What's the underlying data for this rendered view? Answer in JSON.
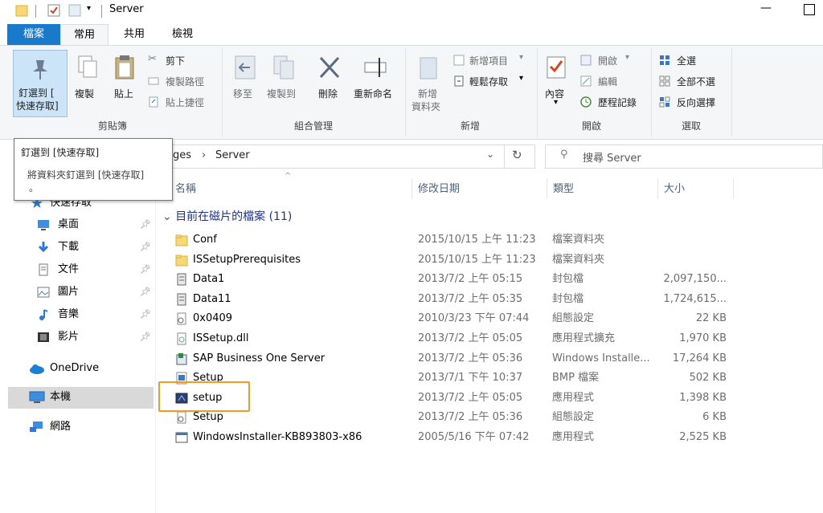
{
  "window": {
    "title": "Server"
  },
  "ribbon": {
    "tabs": [
      "檔案",
      "常用",
      "共用",
      "檢視"
    ],
    "clipboard": {
      "group_label": "剪貼簿",
      "pin_line1": "釘選到 [",
      "pin_line2": "快速存取]",
      "copy": "複製",
      "paste": "貼上",
      "cut": "剪下",
      "copy_path": "複製路徑",
      "paste_shortcut": "貼上捷徑"
    },
    "organize": {
      "group_label": "組合管理",
      "move_to": "移至",
      "copy_to": "複製到",
      "delete": "刪除",
      "rename": "重新命名"
    },
    "new": {
      "group_label": "新增",
      "new_folder_line1": "新增",
      "new_folder_line2": "資料夾",
      "new_item": "新增項目",
      "easy_access": "輕鬆存取"
    },
    "open": {
      "group_label": "開啟",
      "properties": "內容",
      "open": "開啟",
      "edit": "編輯",
      "history": "歷程記錄"
    },
    "select": {
      "group_label": "選取",
      "select_all": "全選",
      "select_none": "全部不選",
      "invert": "反向選擇"
    }
  },
  "tooltip": {
    "title": "釘選到 [快速存取]",
    "desc_line1": "將資料夾釘選到 [快速存取]",
    "desc_line2": "。"
  },
  "address": {
    "partial": "ges",
    "separator": "›",
    "current": "Server"
  },
  "search": {
    "placeholder": "搜尋 Server"
  },
  "columns": {
    "name": "名稱",
    "date": "修改日期",
    "type": "類型",
    "size": "大小"
  },
  "group_header": "目前在磁片的檔案 (11)",
  "nav": {
    "quick_access": "快速存取",
    "items": [
      {
        "label": "桌面",
        "icon": "desktop-icon"
      },
      {
        "label": "下載",
        "icon": "download-icon"
      },
      {
        "label": "文件",
        "icon": "documents-icon"
      },
      {
        "label": "圖片",
        "icon": "pictures-icon"
      },
      {
        "label": "音樂",
        "icon": "music-icon"
      },
      {
        "label": "影片",
        "icon": "videos-icon"
      }
    ],
    "onedrive": "OneDrive",
    "this_pc": "本機",
    "network": "網路"
  },
  "files": [
    {
      "name": "Conf",
      "date": "2015/10/15 上午 11:23",
      "type": "檔案資料夾",
      "size": "",
      "icon": "folder-icon"
    },
    {
      "name": "ISSetupPrerequisites",
      "date": "2015/10/15 上午 11:23",
      "type": "檔案資料夾",
      "size": "",
      "icon": "folder-icon"
    },
    {
      "name": "Data1",
      "date": "2013/7/2 上午 05:15",
      "type": "封包檔",
      "size": "2,097,150...",
      "icon": "cabinet-icon"
    },
    {
      "name": "Data11",
      "date": "2013/7/2 上午 05:35",
      "type": "封包檔",
      "size": "1,724,615...",
      "icon": "cabinet-icon"
    },
    {
      "name": "0x0409",
      "date": "2010/3/23 下午 07:44",
      "type": "組態設定",
      "size": "22 KB",
      "icon": "settings-file-icon"
    },
    {
      "name": "ISSetup.dll",
      "date": "2013/7/2 上午 05:05",
      "type": "應用程式擴充",
      "size": "1,970 KB",
      "icon": "dll-icon"
    },
    {
      "name": "SAP Business One Server",
      "date": "2013/7/2 上午 05:36",
      "type": "Windows Installe...",
      "size": "17,264 KB",
      "icon": "installer-icon"
    },
    {
      "name": "Setup",
      "date": "2013/7/1 下午 10:37",
      "type": "BMP 檔案",
      "size": "502 KB",
      "icon": "bmp-icon"
    },
    {
      "name": "setup",
      "date": "2013/7/2 上午 05:05",
      "type": "應用程式",
      "size": "1,398 KB",
      "icon": "setup-exe-icon"
    },
    {
      "name": "Setup",
      "date": "2013/7/2 上午 05:36",
      "type": "組態設定",
      "size": "6 KB",
      "icon": "settings-file-icon"
    },
    {
      "name": "WindowsInstaller-KB893803-x86",
      "date": "2005/5/16 下午 07:42",
      "type": "應用程式",
      "size": "2,525 KB",
      "icon": "app-icon"
    }
  ],
  "highlight_color": "#f39a25",
  "accent_color": "#1979ca"
}
